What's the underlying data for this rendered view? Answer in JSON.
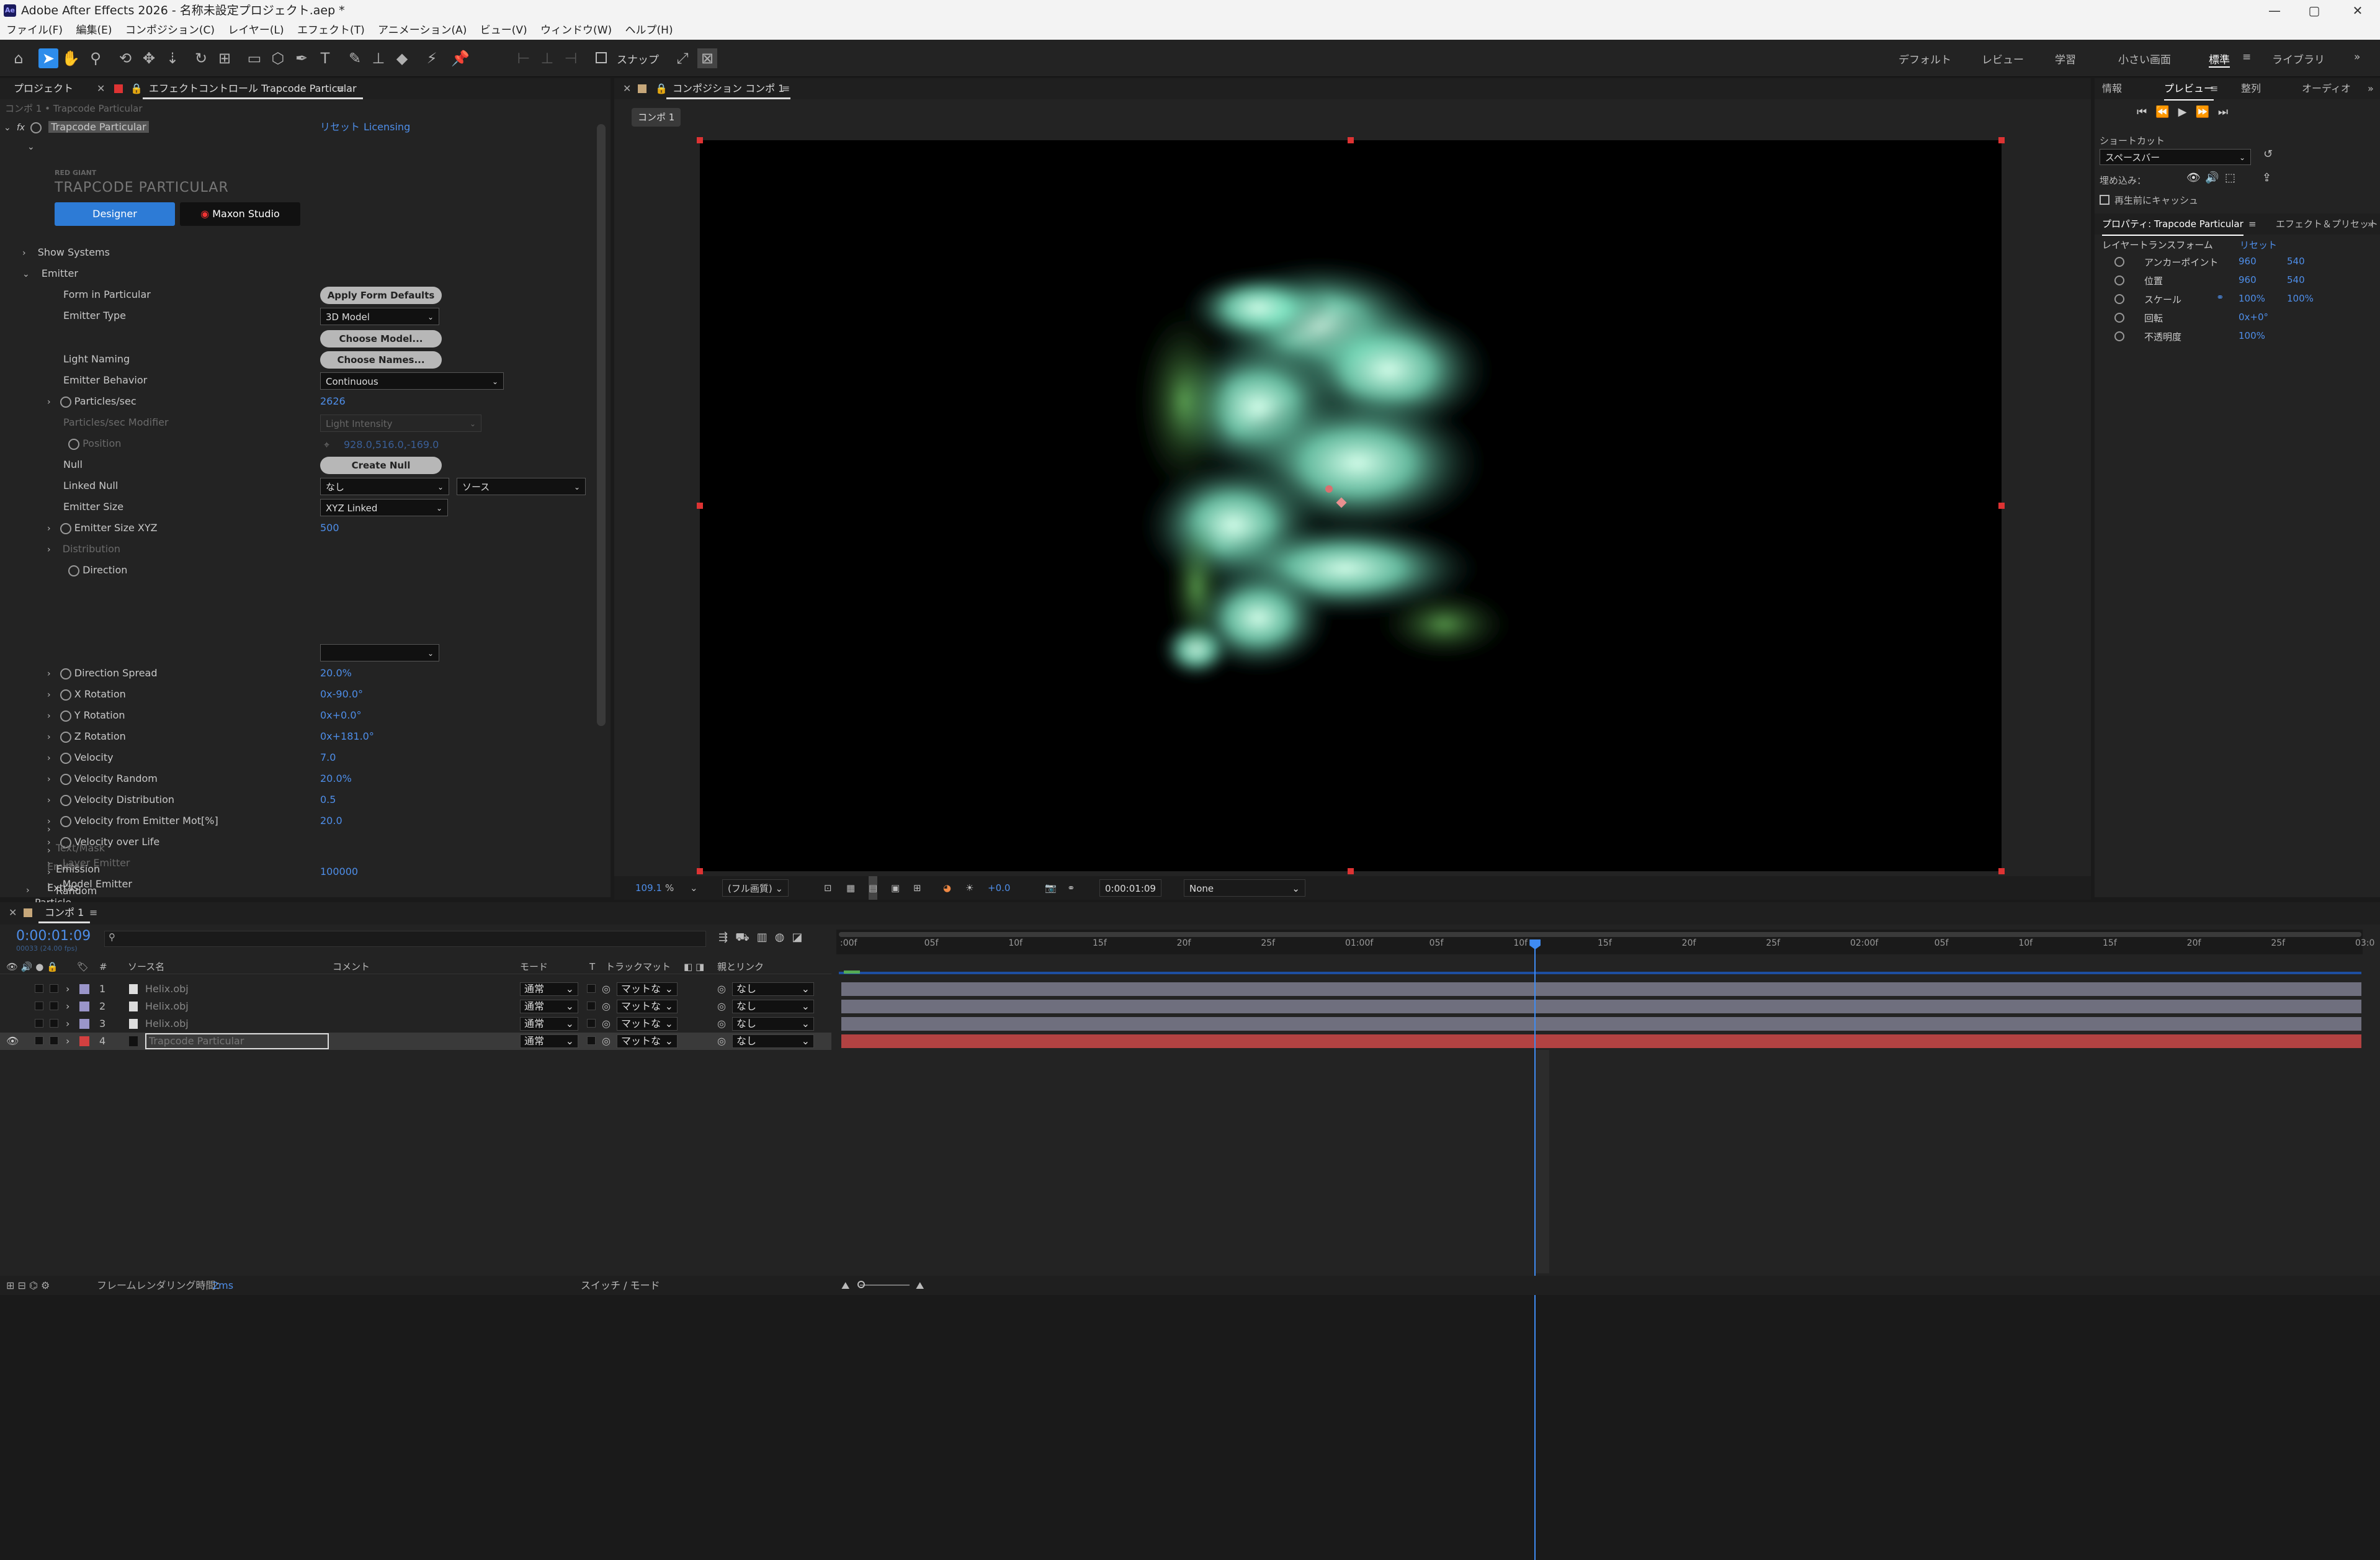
{
  "titlebar": {
    "title": "Adobe After Effects 2026 - 名称未設定プロジェクト.aep *",
    "icon": "ae-logo-icon"
  },
  "menu": [
    "ファイル(F)",
    "編集(E)",
    "コンポジション(C)",
    "レイヤー(L)",
    "エフェクト(T)",
    "アニメーション(A)",
    "ビュー(V)",
    "ウィンドウ(W)",
    "ヘルプ(H)"
  ],
  "toolbar": {
    "snap_label": "スナップ"
  },
  "workspaces": [
    "デフォルト",
    "レビュー",
    "学習",
    "小さい画面",
    "標準",
    "ライブラリ"
  ],
  "fx": {
    "tab_project": "プロジェクト",
    "tab_effect": "エフェクトコントロール Trapcode Particular",
    "breadcrumb": "コンポ 1 • Trapcode Particular",
    "effect_name": "Trapcode Particular",
    "reset": "リセット",
    "licensing": "Licensing",
    "brand": "RED GIANT",
    "product": "TRAPCODE PARTICULAR",
    "designer": "Designer",
    "maxon": "Maxon Studio",
    "show_systems": "Show Systems",
    "emitter": "Emitter",
    "form_in_particular": "Form in Particular",
    "apply_form": "Apply Form Defaults",
    "emitter_type": "Emitter Type",
    "emitter_type_val": "3D Model",
    "choose_model": "Choose Model...",
    "light_naming": "Light Naming",
    "choose_names": "Choose Names...",
    "emitter_behavior": "Emitter Behavior",
    "emitter_behavior_val": "Continuous",
    "particles_sec": "Particles/sec",
    "particles_sec_val": "2626",
    "psm": "Particles/sec Modifier",
    "psm_val": "Light Intensity",
    "position": "Position",
    "position_val": "928.0,516.0,-169.0",
    "null": "Null",
    "create_null": "Create Null",
    "linked_null": "Linked Null",
    "linked_null_val": "なし",
    "linked_null_src": "ソース",
    "emitter_size": "Emitter Size",
    "emitter_size_val": "XYZ Linked",
    "emitter_size_xyz": "Emitter Size XYZ",
    "emitter_size_xyz_val": "500",
    "distribution": "Distribution",
    "direction": "Direction",
    "direction_spread": "Direction Spread",
    "direction_spread_val": "20.0%",
    "x_rotation": "X Rotation",
    "x_rotation_val": "0x-90.0°",
    "y_rotation": "Y Rotation",
    "y_rotation_val": "0x+0.0°",
    "z_rotation": "Z Rotation",
    "z_rotation_val": "0x+181.0°",
    "velocity": "Velocity",
    "velocity_val": "7.0",
    "velocity_random": "Velocity Random",
    "velocity_random_val": "20.0%",
    "velocity_distribution": "Velocity Distribution",
    "velocity_distribution_val": "0.5",
    "velocity_emitter": "Velocity from Emitter Mot[%]",
    "velocity_emitter_val": "20.0",
    "velocity_life": "Velocity over Life",
    "layer_emitter": "Layer Emitter",
    "model_emitter": "Model Emitter",
    "text_mask_emitter": "Text/Mask Emitter",
    "emission_extras": "Emission Extras",
    "random_seed": "Random Seed",
    "random_seed_val": "100000",
    "particle": "Particle"
  },
  "comp": {
    "tab": "コンポジション コンポ 1",
    "subtab": "コンポ 1",
    "zoom": "109.1",
    "zoom_unit": "%",
    "resolution": "(フル画質)",
    "exposure": "+0.0",
    "timecode": "0:00:01:09",
    "view": "None"
  },
  "right": {
    "tabs": [
      "情報",
      "プレビュー",
      "整列",
      "オーディオ"
    ],
    "shortcut": "ショートカット",
    "shortcut_val": "スペースバー",
    "embed": "埋め込み：",
    "cache": "再生前にキャッシュ",
    "prop_tab": "プロパティ: Trapcode Particular",
    "fx_tab": "エフェクト＆プリセット",
    "layer_transform": "レイヤートランスフォーム",
    "reset": "リセット",
    "props": [
      {
        "name": "アンカーポイント",
        "v1": "960",
        "v2": "540"
      },
      {
        "name": "位置",
        "v1": "960",
        "v2": "540"
      },
      {
        "name": "スケール",
        "v1": "100%",
        "v2": "100%"
      },
      {
        "name": "回転",
        "v1": "0x+0°",
        "v2": ""
      },
      {
        "name": "不透明度",
        "v1": "100%",
        "v2": ""
      }
    ]
  },
  "timeline": {
    "tab": "コンポ 1",
    "timecode": "0:00:01:09",
    "sub_timecode": "00033 (24.00 fps)",
    "search_icon": "search-icon",
    "col_source": "ソース名",
    "col_comment": "コメント",
    "col_mode": "モード",
    "col_t": "T",
    "col_trackmatte": "トラックマット",
    "col_parent": "親とリンク",
    "ruler": [
      ":00f",
      "05f",
      "10f",
      "15f",
      "20f",
      "25f",
      "01:00f",
      "05f",
      "10f",
      "15f",
      "20f",
      "25f",
      "02:00f",
      "05f",
      "10f",
      "15f",
      "20f",
      "25f",
      "03:0"
    ],
    "layers": [
      {
        "num": "1",
        "name": "Helix.obj",
        "mode": "通常",
        "matte": "マットな",
        "parent": "なし"
      },
      {
        "num": "2",
        "name": "Helix.obj",
        "mode": "通常",
        "matte": "マットな",
        "parent": "なし"
      },
      {
        "num": "3",
        "name": "Helix.obj",
        "mode": "通常",
        "matte": "マットな",
        "parent": "なし"
      },
      {
        "num": "4",
        "name": "Trapcode Particular",
        "mode": "通常",
        "matte": "マットな",
        "parent": "なし"
      }
    ],
    "playhead_frames": 33,
    "total_frames": 72,
    "colors": {
      "layer_bar": "#6f6f7e",
      "particular_bar": "#b24242",
      "playhead": "#3f8bf2",
      "label_lavender": "#9a95c9",
      "label_red": "#d24040"
    }
  },
  "status": {
    "render_label": "フレームレンダリング時間：",
    "render_val": "2ms",
    "switch_mode": "スイッチ / モード"
  }
}
